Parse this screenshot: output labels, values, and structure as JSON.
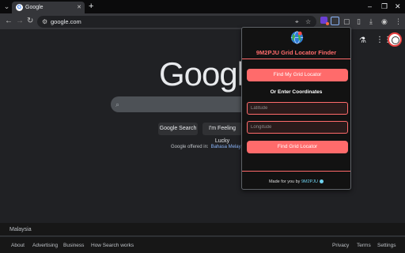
{
  "browser": {
    "tab_title": "Google",
    "tab_favicon": "G",
    "new_tab_glyph": "+",
    "url": "google.com"
  },
  "google": {
    "logo": "Google",
    "search_button": "Google Search",
    "lucky_button": "I'm Feeling Lucky",
    "offered_in": "Google offered in:",
    "offered_lang": "Bahasa Melayu",
    "country": "Malaysia",
    "footer_left": [
      "About",
      "Advertising",
      "Business",
      "How Search works"
    ],
    "footer_right": [
      "Privacy",
      "Terms",
      "Settings"
    ]
  },
  "popup": {
    "title": "9M2PJU Grid Locator Finder",
    "find_button": "Find My Grid Locator",
    "or_text": "Or Enter Coordinates",
    "lat_placeholder": "Latitude",
    "lon_placeholder": "Longitude",
    "find_grid_button": "Find Grid Locator",
    "made_for": "Made for you by",
    "author": "9M2PJU"
  },
  "colors": {
    "accent": "#ff6b6b",
    "page_bg": "#202124",
    "author": "#6fd3f0"
  },
  "icons": [
    "chevron-down-icon",
    "google-favicon-icon",
    "close-icon",
    "plus-icon",
    "minimize-icon",
    "maximize-icon",
    "window-close-icon",
    "back-icon",
    "forward-icon",
    "reload-icon",
    "site-info-icon",
    "location-icon",
    "translate-icon",
    "star-icon",
    "extension-icon",
    "puzzle-icon",
    "sidebar-icon",
    "download-icon",
    "profile-icon",
    "menu-icon",
    "labs-icon",
    "apps-grid-icon",
    "avatar",
    "search-icon",
    "globe-icon"
  ]
}
